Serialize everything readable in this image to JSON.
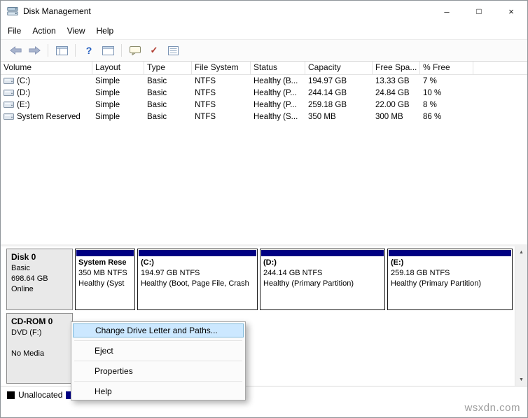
{
  "colors": {
    "partition_bar": "#000082",
    "menu_highlight_bg": "#cce8ff",
    "menu_highlight_border": "#7fbadc"
  },
  "window": {
    "title": "Disk Management",
    "controls": {
      "minimize": "–",
      "maximize": "□",
      "close": "×"
    }
  },
  "menubar": {
    "items": [
      "File",
      "Action",
      "View",
      "Help"
    ]
  },
  "toolbar": {
    "icons": [
      "back-arrow",
      "forward-arrow",
      "console-tree",
      "help",
      "console-window",
      "popup-menu",
      "action-check",
      "report-list"
    ]
  },
  "glyphs": {
    "help": "?",
    "check": "✓",
    "scroll_up": "▲",
    "scroll_down": "▼"
  },
  "volume_table": {
    "columns": [
      "Volume",
      "Layout",
      "Type",
      "File System",
      "Status",
      "Capacity",
      "Free Spa...",
      "% Free"
    ],
    "rows": [
      {
        "volume": "(C:)",
        "layout": "Simple",
        "type": "Basic",
        "file_system": "NTFS",
        "status": "Healthy (B...",
        "capacity": "194.97 GB",
        "free_space": "13.33 GB",
        "pct_free": "7 %"
      },
      {
        "volume": "(D:)",
        "layout": "Simple",
        "type": "Basic",
        "file_system": "NTFS",
        "status": "Healthy (P...",
        "capacity": "244.14 GB",
        "free_space": "24.84 GB",
        "pct_free": "10 %"
      },
      {
        "volume": "(E:)",
        "layout": "Simple",
        "type": "Basic",
        "file_system": "NTFS",
        "status": "Healthy (P...",
        "capacity": "259.18 GB",
        "free_space": "22.00 GB",
        "pct_free": "8 %"
      },
      {
        "volume": "System Reserved",
        "layout": "Simple",
        "type": "Basic",
        "file_system": "NTFS",
        "status": "Healthy (S...",
        "capacity": "350 MB",
        "free_space": "300 MB",
        "pct_free": "86 %"
      }
    ]
  },
  "disk0": {
    "name": "Disk 0",
    "kind": "Basic",
    "size": "698.64 GB",
    "status": "Online",
    "partitions": [
      {
        "title": "System Rese",
        "size": "350 MB NTFS",
        "status": "Healthy (Syst"
      },
      {
        "title": "(C:)",
        "size": "194.97 GB NTFS",
        "status": "Healthy (Boot, Page File, Crash"
      },
      {
        "title": "(D:)",
        "size": "244.14 GB NTFS",
        "status": "Healthy (Primary Partition)"
      },
      {
        "title": "(E:)",
        "size": "259.18 GB NTFS",
        "status": "Healthy (Primary Partition)"
      }
    ]
  },
  "cdrom0": {
    "name": "CD-ROM 0",
    "drive": "DVD (F:)",
    "media": "No Media"
  },
  "context_menu": {
    "highlighted_index": 0,
    "items": [
      "Change Drive Letter and Paths...",
      "Eject",
      "Properties",
      "Help"
    ]
  },
  "legend": {
    "unallocated_label": "Unallocated"
  },
  "watermark": "wsxdn.com"
}
